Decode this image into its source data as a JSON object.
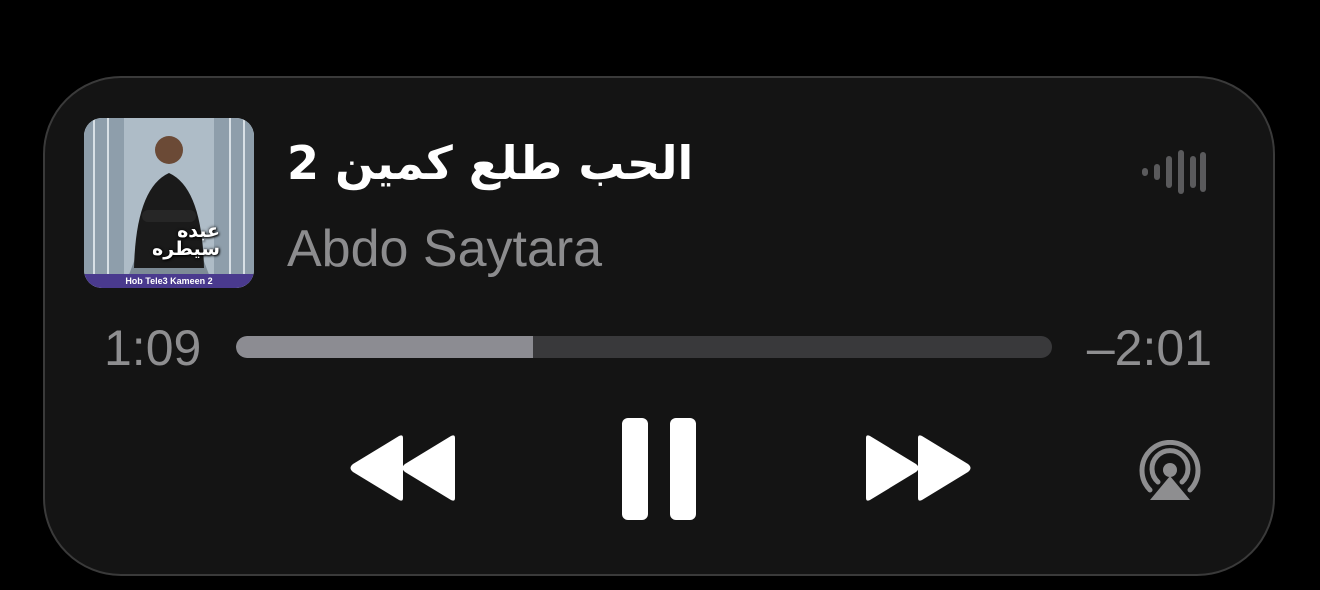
{
  "now_playing": {
    "title": "الحب طلع كمين 2",
    "artist": "Abdo Saytara"
  },
  "artwork": {
    "name_text": "عبده سيطره",
    "caption": "Hob Tele3 Kameen 2"
  },
  "playback": {
    "elapsed": "1:09",
    "remaining": "–2:01",
    "progress_fraction": 0.364,
    "state": "playing"
  },
  "icons": {
    "rewind": "backward-icon",
    "pause": "pause-icon",
    "forward": "forward-icon",
    "airplay": "airplay-icon",
    "waveform": "waveform-icon"
  },
  "colors": {
    "background": "#000000",
    "panel": "#141414",
    "primary_text": "#ffffff",
    "secondary_text": "#8c8c8e",
    "progress_fill": "#8c8c92",
    "progress_track": "#39393b"
  }
}
